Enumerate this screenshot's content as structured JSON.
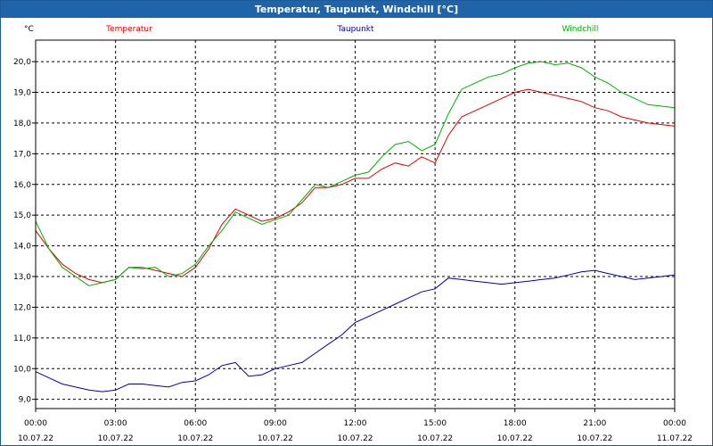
{
  "window": {
    "title": "Temperatur, Taupunkt, Windchill [°C]"
  },
  "chart_data": {
    "type": "line",
    "title": "Temperatur, Taupunkt, Windchill [°C]",
    "ylabel": "°C",
    "xlabel": "",
    "ylim": [
      8.7,
      20.7
    ],
    "xlim": [
      0,
      24
    ],
    "grid": true,
    "legend_position": "top",
    "x_tick_times": [
      "00:00",
      "03:00",
      "06:00",
      "09:00",
      "12:00",
      "15:00",
      "18:00",
      "21:00",
      "00:00"
    ],
    "x_tick_dates": [
      "10.07.22",
      "10.07.22",
      "10.07.22",
      "10.07.22",
      "10.07.22",
      "10.07.22",
      "10.07.22",
      "10.07.22",
      "11.07.22"
    ],
    "y_ticks": [
      "9,0",
      "10,0",
      "11,0",
      "12,0",
      "13,0",
      "14,0",
      "15,0",
      "16,0",
      "17,0",
      "18,0",
      "19,0",
      "20,0"
    ],
    "x_tick_hours": [
      0,
      3,
      6,
      9,
      12,
      15,
      18,
      21,
      24
    ],
    "y_tick_values": [
      9,
      10,
      11,
      12,
      13,
      14,
      15,
      16,
      17,
      18,
      19,
      20
    ],
    "series": [
      {
        "name": "Temperatur",
        "color": "#e00000",
        "x": [
          0,
          0.5,
          1,
          1.5,
          2,
          2.5,
          3,
          3.5,
          4,
          4.5,
          5,
          5.5,
          6,
          6.5,
          7,
          7.5,
          8,
          8.5,
          9,
          9.5,
          10,
          10.5,
          11,
          11.5,
          12,
          12.5,
          13,
          13.5,
          14,
          14.5,
          15,
          15.5,
          16,
          16.5,
          17,
          17.5,
          18,
          18.5,
          19,
          19.5,
          20,
          20.5,
          21,
          21.5,
          22,
          22.5,
          23,
          23.5,
          24
        ],
        "values": [
          14.5,
          13.9,
          13.4,
          13.1,
          12.9,
          12.8,
          12.9,
          13.3,
          13.3,
          13.2,
          13.1,
          13.0,
          13.3,
          13.9,
          14.7,
          15.2,
          15.0,
          14.8,
          14.9,
          15.1,
          15.4,
          15.9,
          15.9,
          16.0,
          16.2,
          16.2,
          16.5,
          16.7,
          16.6,
          16.9,
          16.7,
          17.6,
          18.2,
          18.4,
          18.6,
          18.8,
          19.0,
          19.1,
          19.0,
          18.9,
          18.8,
          18.7,
          18.5,
          18.4,
          18.2,
          18.1,
          18.0,
          17.95,
          17.9
        ]
      },
      {
        "name": "Taupunkt",
        "color": "#0000a8",
        "x": [
          0,
          0.5,
          1,
          1.5,
          2,
          2.5,
          3,
          3.5,
          4,
          4.5,
          5,
          5.5,
          6,
          6.5,
          7,
          7.5,
          8,
          8.5,
          9,
          9.5,
          10,
          10.5,
          11,
          11.5,
          12,
          12.5,
          13,
          13.5,
          14,
          14.5,
          15,
          15.5,
          16,
          16.5,
          17,
          17.5,
          18,
          18.5,
          19,
          19.5,
          20,
          20.5,
          21,
          21.5,
          22,
          22.5,
          23,
          23.5,
          24
        ],
        "values": [
          9.9,
          9.7,
          9.5,
          9.4,
          9.3,
          9.25,
          9.3,
          9.5,
          9.5,
          9.45,
          9.4,
          9.55,
          9.6,
          9.8,
          10.1,
          10.2,
          9.75,
          9.8,
          10.0,
          10.1,
          10.2,
          10.5,
          10.8,
          11.1,
          11.5,
          11.7,
          11.9,
          12.1,
          12.3,
          12.5,
          12.6,
          12.95,
          12.9,
          12.85,
          12.8,
          12.75,
          12.8,
          12.85,
          12.9,
          12.95,
          13.05,
          13.15,
          13.2,
          13.1,
          13.0,
          12.9,
          12.95,
          13.0,
          13.05
        ]
      },
      {
        "name": "Windchill",
        "color": "#00b000",
        "x": [
          0,
          0.5,
          1,
          1.5,
          2,
          2.5,
          3,
          3.5,
          4,
          4.5,
          5,
          5.5,
          6,
          6.5,
          7,
          7.5,
          8,
          8.5,
          9,
          9.5,
          10,
          10.5,
          11,
          11.5,
          12,
          12.5,
          13,
          13.5,
          14,
          14.5,
          15,
          15.5,
          16,
          16.5,
          17,
          17.5,
          18,
          18.5,
          19,
          19.5,
          20,
          20.5,
          21,
          21.5,
          22,
          22.5,
          23,
          23.5,
          24
        ],
        "values": [
          14.8,
          13.9,
          13.3,
          13.0,
          12.7,
          12.8,
          12.9,
          13.3,
          13.25,
          13.3,
          13.0,
          13.1,
          13.4,
          14.0,
          14.5,
          15.1,
          14.9,
          14.7,
          14.85,
          15.0,
          15.5,
          16.0,
          15.9,
          16.1,
          16.3,
          16.4,
          16.9,
          17.3,
          17.4,
          17.1,
          17.3,
          18.3,
          19.1,
          19.3,
          19.5,
          19.6,
          19.8,
          19.95,
          20.0,
          19.9,
          19.95,
          19.8,
          19.5,
          19.3,
          19.0,
          18.8,
          18.6,
          18.55,
          18.5
        ]
      }
    ]
  }
}
